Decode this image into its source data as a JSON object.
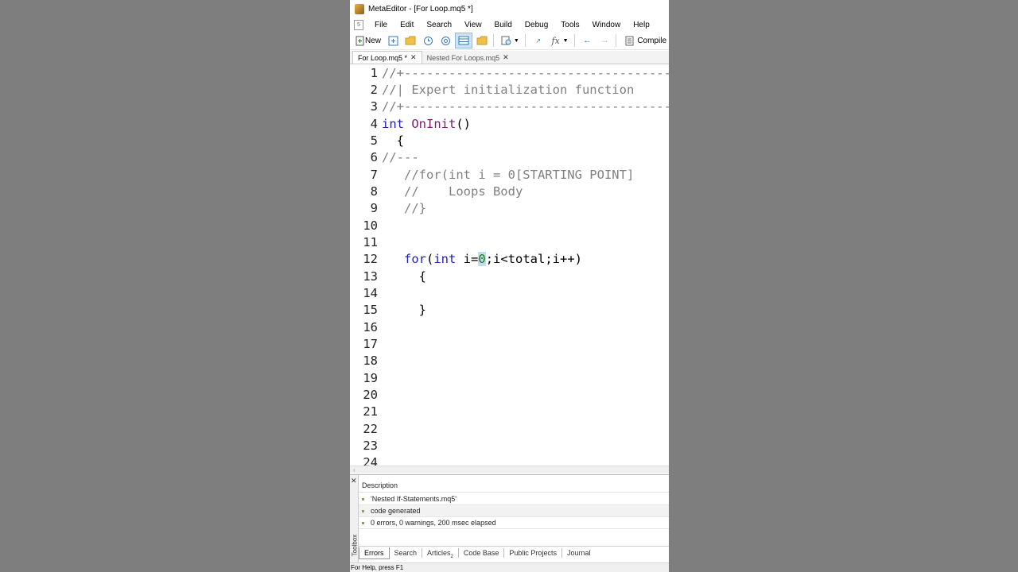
{
  "window": {
    "title": "MetaEditor - [For Loop.mq5 *]"
  },
  "menu": [
    "File",
    "Edit",
    "Search",
    "View",
    "Build",
    "Debug",
    "Tools",
    "Window",
    "Help"
  ],
  "toolbar": {
    "new_label": "New",
    "compile_label": "Compile"
  },
  "tabs": [
    {
      "label": "For Loop.mq5 *",
      "active": true
    },
    {
      "label": "Nested For Loops.mq5",
      "active": false
    }
  ],
  "editor": {
    "line_numbers": [
      "1",
      "2",
      "3",
      "4",
      "5",
      "6",
      "7",
      "8",
      "9",
      "10",
      "11",
      "12",
      "13",
      "14",
      "15",
      "16",
      "17",
      "18",
      "19",
      "20",
      "21",
      "22",
      "23",
      "24"
    ],
    "lines": [
      {
        "text": "//+------------------------------------------------------------------+",
        "kind": "comment"
      },
      {
        "text": "//| Expert initialization function",
        "kind": "comment"
      },
      {
        "text": "//+------------------------------------------------------------------+",
        "kind": "comment"
      },
      {
        "kw": "int",
        "fn": "OnInit",
        "rest": "()"
      },
      {
        "text": "  {",
        "kind": "text"
      },
      {
        "text": "//---",
        "kind": "comment"
      },
      {
        "text": "   //for(int i = 0[STARTING POINT]",
        "kind": "comment"
      },
      {
        "text": "   //    Loops Body",
        "kind": "comment"
      },
      {
        "text": "   //}",
        "kind": "comment"
      },
      {
        "text": "",
        "kind": "text"
      },
      {
        "text": "",
        "kind": "text"
      },
      {
        "pre": "   ",
        "kw1": "for",
        "mid1": "(",
        "kw2": "int",
        "mid2": " i=",
        "num": "0",
        "rest": ";i<total;i++)"
      },
      {
        "text": "     {",
        "kind": "text"
      },
      {
        "text": "",
        "kind": "text"
      },
      {
        "text": "     }",
        "kind": "text"
      }
    ]
  },
  "toolbox": {
    "side_label": "Toolbox",
    "header": "Description",
    "messages": [
      "'Nested If-Statements.mq5'",
      "code generated",
      "0 errors, 0 warnings, 200 msec elapsed"
    ],
    "tabs": [
      "Errors",
      "Search",
      "Articles",
      "Code Base",
      "Public Projects",
      "Journal"
    ],
    "articles_badge": "2"
  },
  "status": {
    "text": "For Help, press F1"
  },
  "colors": {
    "keyword": "#1f1fb5",
    "function": "#7a1e7a",
    "comment": "#808080",
    "number": "#1e7a1e"
  }
}
